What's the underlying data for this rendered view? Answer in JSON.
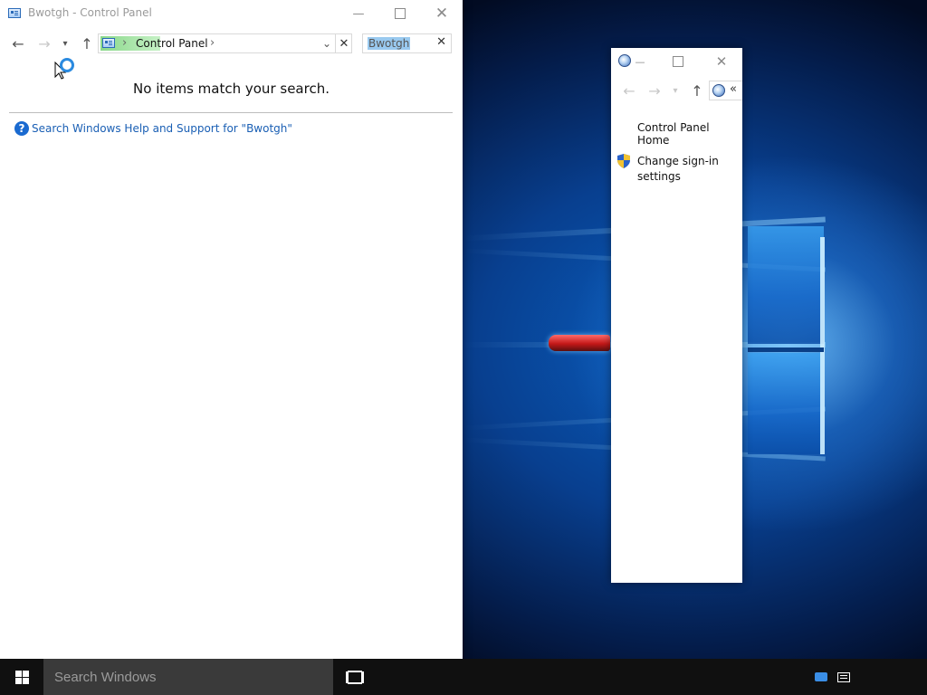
{
  "main_window": {
    "title": "Bwotgh - Control Panel",
    "breadcrumb_sep": "›",
    "breadcrumb": "Control Panel",
    "search_value": "Bwotgh",
    "empty_message": "No items match your search.",
    "help_link": "Search Windows Help and Support for \"Bwotgh\""
  },
  "second_window": {
    "address_overflow": "«",
    "links": {
      "home": "Control Panel Home",
      "change_signin": "Change sign-in settings"
    }
  },
  "taskbar": {
    "search_placeholder": "Search Windows"
  },
  "colors": {
    "link": "#1a5fb4",
    "breadcrumb_highlight": "#a9e7a9",
    "search_selection": "#99c9ef"
  }
}
